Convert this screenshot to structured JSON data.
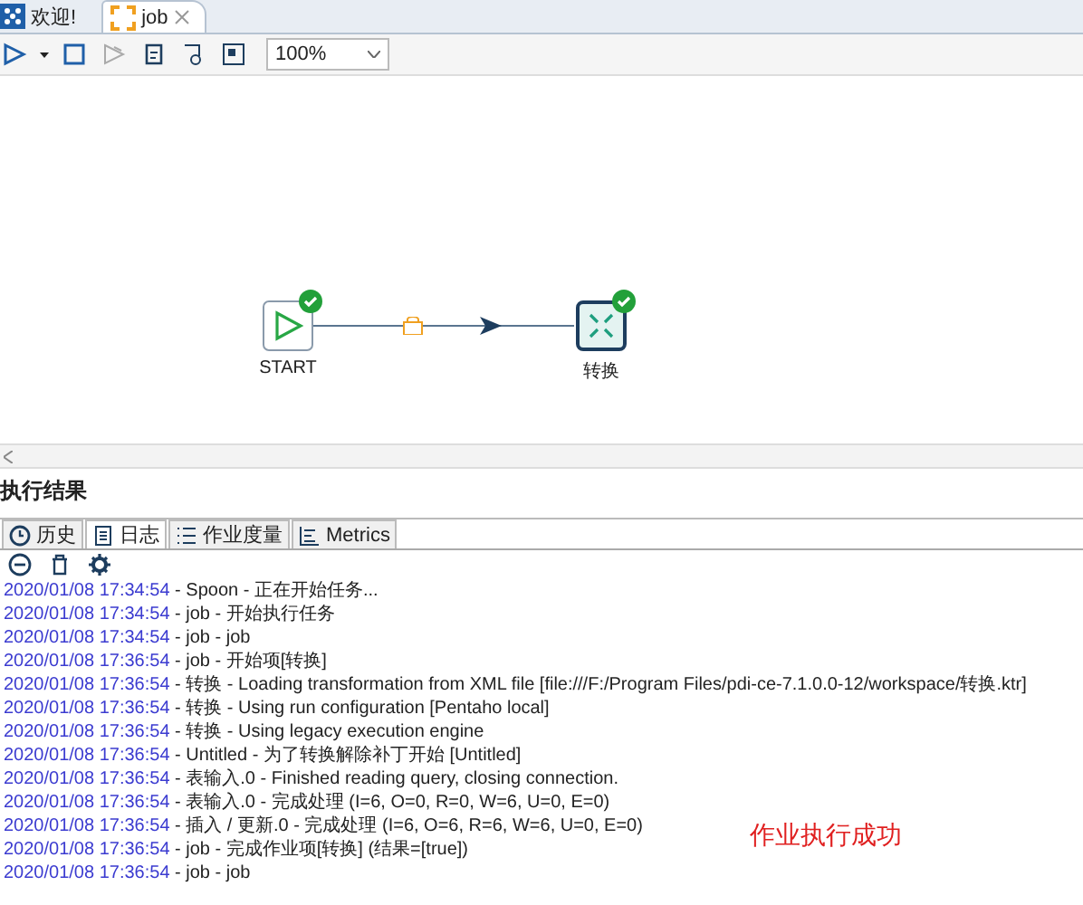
{
  "editor_tabs": [
    {
      "label": "欢迎!",
      "kind": "welcome",
      "selected": false,
      "closable": false
    },
    {
      "label": "job",
      "kind": "job",
      "selected": true,
      "closable": true
    }
  ],
  "toolbar": {
    "zoom": "100%"
  },
  "canvas": {
    "nodes": [
      {
        "label": "START",
        "kind": "start",
        "ok": true
      },
      {
        "label": "转换",
        "kind": "transform",
        "ok": true
      }
    ],
    "hop": {
      "locked": true
    }
  },
  "results": {
    "title": "执行结果",
    "tabs": [
      {
        "label": "历史",
        "kind": "history",
        "selected": false
      },
      {
        "label": "日志",
        "kind": "log",
        "selected": true
      },
      {
        "label": "作业度量",
        "kind": "metrics-list",
        "selected": false
      },
      {
        "label": "Metrics",
        "kind": "metrics",
        "selected": false
      }
    ],
    "log": [
      {
        "time": "2020/01/08 17:34:54",
        "message": " - Spoon - 正在开始任务..."
      },
      {
        "time": "2020/01/08 17:34:54",
        "message": " - job - 开始执行任务"
      },
      {
        "time": "2020/01/08 17:34:54",
        "message": " - job - job"
      },
      {
        "time": "2020/01/08 17:36:54",
        "message": " - job - 开始项[转换]"
      },
      {
        "time": "2020/01/08 17:36:54",
        "message": " - 转换 - Loading transformation from XML file [file:///F:/Program Files/pdi-ce-7.1.0.0-12/workspace/转换.ktr]"
      },
      {
        "time": "2020/01/08 17:36:54",
        "message": " - 转换 - Using run configuration [Pentaho local]"
      },
      {
        "time": "2020/01/08 17:36:54",
        "message": " - 转换 - Using legacy execution engine"
      },
      {
        "time": "2020/01/08 17:36:54",
        "message": " - Untitled - 为了转换解除补丁开始  [Untitled]"
      },
      {
        "time": "2020/01/08 17:36:54",
        "message": " - 表输入.0 - Finished reading query, closing connection."
      },
      {
        "time": "2020/01/08 17:36:54",
        "message": " - 表输入.0 - 完成处理 (I=6, O=0, R=0, W=6, U=0, E=0)"
      },
      {
        "time": "2020/01/08 17:36:54",
        "message": " - 插入 / 更新.0 - 完成处理 (I=6, O=6, R=6, W=6, U=0, E=0)"
      },
      {
        "time": "2020/01/08 17:36:54",
        "message": " - job - 完成作业项[转换] (结果=[true])"
      },
      {
        "time": "2020/01/08 17:36:54",
        "message": " - job - job"
      }
    ],
    "annotation": "作业执行成功"
  }
}
